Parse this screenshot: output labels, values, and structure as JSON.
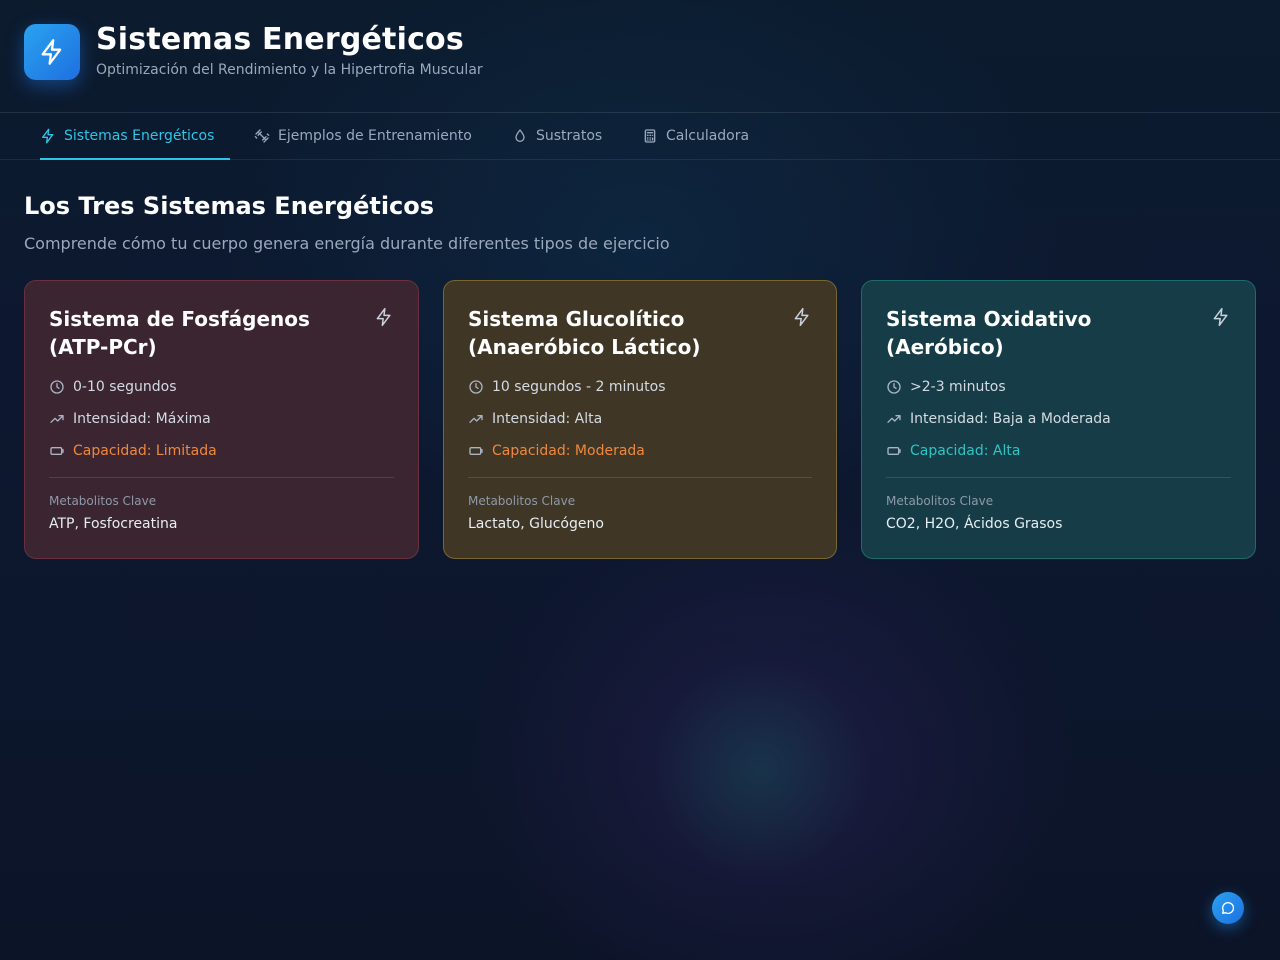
{
  "header": {
    "title": "Sistemas Energéticos",
    "subtitle": "Optimización del Rendimiento y la Hipertrofia Muscular",
    "logo_icon": "bolt-icon"
  },
  "tabs": [
    {
      "label": "Sistemas Energéticos",
      "icon": "bolt-icon",
      "active": true
    },
    {
      "label": "Ejemplos de Entrenamiento",
      "icon": "dumbbell-icon",
      "active": false
    },
    {
      "label": "Sustratos",
      "icon": "droplet-icon",
      "active": false
    },
    {
      "label": "Calculadora",
      "icon": "calculator-icon",
      "active": false
    }
  ],
  "main": {
    "title": "Los Tres Sistemas Energéticos",
    "subtitle": "Comprende cómo tu cuerpo genera energía durante diferentes tipos de ejercicio"
  },
  "cards": [
    {
      "title": "Sistema de Fosfágenos (ATP-PCr)",
      "duration": "0-10 segundos",
      "intensity": "Intensidad: Máxima",
      "capacity": "Capacidad: Limitada",
      "metabolites_label": "Metabolitos Clave",
      "metabolites": "ATP, Fosfocreatina",
      "accent": "#f0883e"
    },
    {
      "title": "Sistema Glucolítico (Anaeróbico Láctico)",
      "duration": "10 segundos - 2 minutos",
      "intensity": "Intensidad: Alta",
      "capacity": "Capacidad: Moderada",
      "metabolites_label": "Metabolitos Clave",
      "metabolites": "Lactato, Glucógeno",
      "accent": "#f0883e"
    },
    {
      "title": "Sistema Oxidativo (Aeróbico)",
      "duration": ">2-3 minutos",
      "intensity": "Intensidad: Baja a Moderada",
      "capacity": "Capacidad: Alta",
      "metabolites_label": "Metabolitos Clave",
      "metabolites": "CO2, H2O, Ácidos Grasos",
      "accent": "#2ec4c4"
    }
  ],
  "chat_button": {
    "icon": "chat-icon"
  }
}
